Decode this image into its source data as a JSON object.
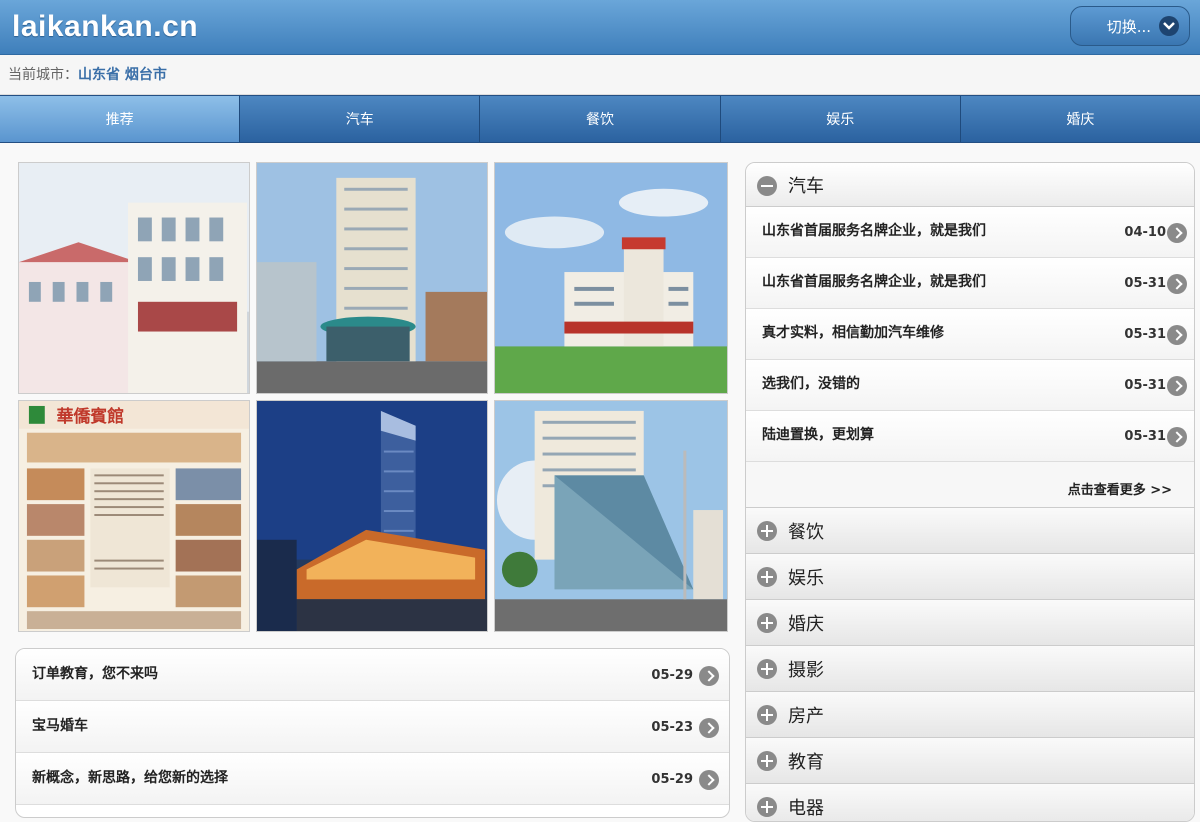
{
  "header": {
    "logo": "laikankan.cn",
    "switch_label": "切换..."
  },
  "city": {
    "label": "当前城市：",
    "value": "山东省 烟台市"
  },
  "nav": {
    "tabs": [
      "推荐",
      "汽车",
      "餐饮",
      "娱乐",
      "婚庆"
    ]
  },
  "left_list": [
    {
      "title": "订单教育，您不来吗",
      "date": "05-29"
    },
    {
      "title": "宝马婚车",
      "date": "05-23"
    },
    {
      "title": "新概念，新思路，给您新的选择",
      "date": "05-29"
    }
  ],
  "gallery": {
    "hotel_banner": "華僑賓館"
  },
  "sidebar": {
    "open_section": {
      "title": "汽车",
      "items": [
        {
          "title": "山东省首届服务名牌企业，就是我们",
          "date": "04-10"
        },
        {
          "title": "山东省首届服务名牌企业，就是我们",
          "date": "05-31"
        },
        {
          "title": "真才实料，相信勤加汽车维修",
          "date": "05-31"
        },
        {
          "title": "选我们，没错的",
          "date": "05-31"
        },
        {
          "title": "陆迪置换，更划算",
          "date": "05-31"
        }
      ],
      "more": "点击查看更多 >>"
    },
    "sections": [
      "餐饮",
      "娱乐",
      "婚庆",
      "摄影",
      "房产",
      "教育",
      "电器"
    ]
  },
  "colors": {
    "header": "#3f7fbb",
    "nav": "#2b62a0",
    "nav_active": "#5a95cf",
    "city": "#3a6fa8"
  }
}
